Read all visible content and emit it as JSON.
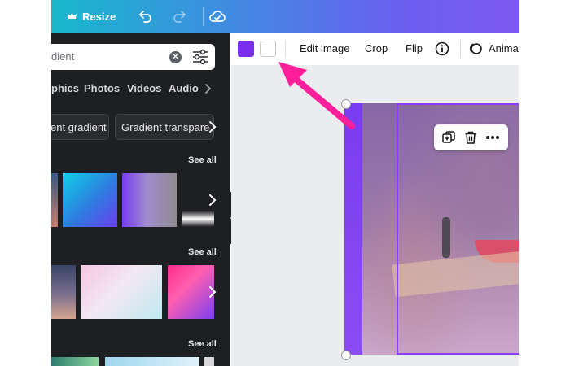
{
  "topbar": {
    "resize_label": "Resize",
    "icons": [
      "crown-icon",
      "undo-icon",
      "redo-icon",
      "cloud-sync-icon"
    ]
  },
  "panel": {
    "search_value": "gradient",
    "search_visible_text": "dient",
    "tabs": [
      "phics",
      "Photos",
      "Videos",
      "Audio"
    ],
    "chips": [
      "ent gradient",
      "Gradient transpare"
    ],
    "see_all": "See all"
  },
  "toolbar": {
    "swatches": [
      "#7a2ff0",
      "#ffffff"
    ],
    "edit_image": "Edit image",
    "crop": "Crop",
    "flip": "Flip",
    "animate": "Anima"
  },
  "colors": {
    "accent": "#8b3dff",
    "arrow": "#ff1f9a",
    "panel_bg": "#1e1f22"
  }
}
